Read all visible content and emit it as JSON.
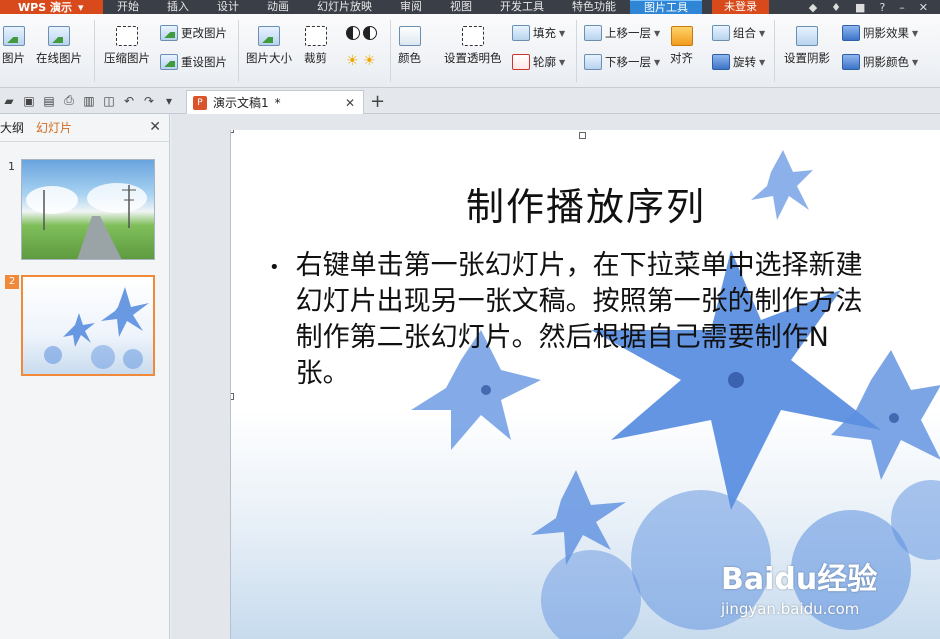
{
  "app": {
    "logo": "WPS 演示",
    "menu": [
      "开始",
      "插入",
      "设计",
      "动画",
      "幻灯片放映",
      "审阅",
      "视图",
      "开发工具",
      "特色功能",
      "图片工具"
    ],
    "active_menu": "图片工具",
    "login": "未登录"
  },
  "ribbon": {
    "picture": "图片",
    "online_picture": "在线图片",
    "compress": "压缩图片",
    "change_picture": "更改图片",
    "reset_picture": "重设图片",
    "picture_size": "图片大小",
    "crop": "裁剪",
    "color": "颜色",
    "set_transparent": "设置透明色",
    "fill": "填充",
    "outline": "轮廓",
    "bring_forward": "上移一层",
    "send_backward": "下移一层",
    "align": "对齐",
    "group": "组合",
    "rotate": "旋转",
    "set_shadow": "设置阴影",
    "shadow_effect": "阴影效果",
    "shadow_color": "阴影颜色"
  },
  "tabs": {
    "doc_name": "演示文稿1",
    "modified_mark": "*"
  },
  "left_panel": {
    "tab_outline": "大纲",
    "tab_slides": "幻灯片",
    "slides": [
      {
        "number": "1"
      },
      {
        "number": "2"
      }
    ],
    "selected": "2"
  },
  "slide": {
    "title": "制作播放序列",
    "bullet": "•",
    "body": "右键单击第一张幻灯片，在下拉菜单中选择新建幻灯片出现另一张文稿。按照第一张的制作方法制作第二张幻灯片。然后根据自己需要制作N张。"
  },
  "watermark": {
    "brand": "Baidu经验",
    "url": "jingyan.baidu.com"
  },
  "colors": {
    "accent": "#2f86d6",
    "brand_orange": "#d84a1b",
    "selection_orange": "#f08a3a",
    "flower_blue": "#5b8fe0"
  }
}
